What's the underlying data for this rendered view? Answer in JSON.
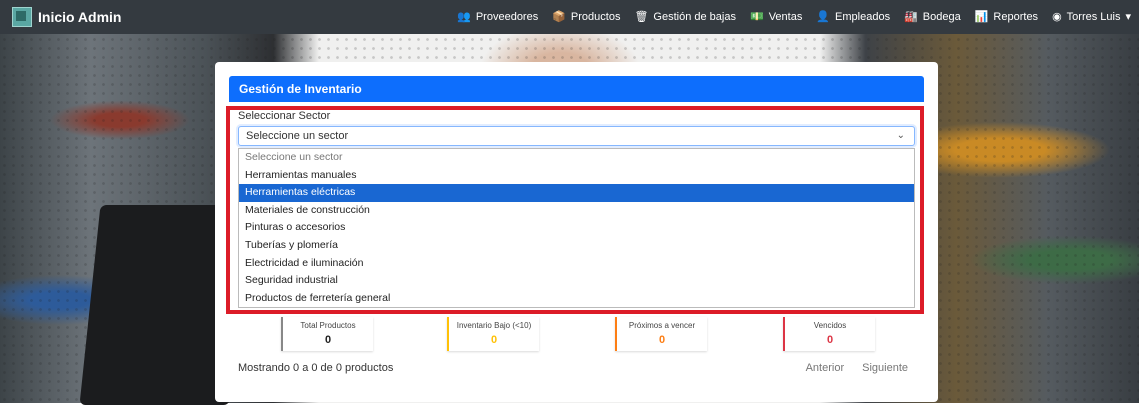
{
  "navbar": {
    "brand": "Inicio Admin",
    "items": [
      {
        "icon": "users-icon",
        "glyph": "👥",
        "label": "Proveedores"
      },
      {
        "icon": "box-icon",
        "glyph": "📦",
        "label": "Productos"
      },
      {
        "icon": "trash-icon",
        "glyph": "🗑",
        "label": "Gestión de bajas"
      },
      {
        "icon": "money-icon",
        "glyph": "💵",
        "label": "Ventas"
      },
      {
        "icon": "user-icon",
        "glyph": "👤",
        "label": "Empleados"
      },
      {
        "icon": "warehouse-icon",
        "glyph": "🏭",
        "label": "Bodega"
      },
      {
        "icon": "report-icon",
        "glyph": "📊",
        "label": "Reportes"
      }
    ],
    "user": "Torres Luis"
  },
  "card": {
    "title": "Gestión de Inventario",
    "sector_label": "Seleccionar Sector",
    "select_value": "Seleccione un sector",
    "options": [
      "Seleccione un sector",
      "Herramientas manuales",
      "Herramientas eléctricas",
      "Materiales de construcción",
      "Pinturas o accesorios",
      "Tuberías y plomería",
      "Electricidad e iluminación",
      "Seguridad industrial",
      "Productos de ferretería general"
    ],
    "selected_option": "Herramientas eléctricas"
  },
  "stats": [
    {
      "label": "Total Productos",
      "value": "0",
      "color": "#888888"
    },
    {
      "label": "Inventario Bajo (<10)",
      "value": "0",
      "color": "#ffc107"
    },
    {
      "label": "Próximos a vencer",
      "value": "0",
      "color": "#fd7e14"
    },
    {
      "label": "Vencidos",
      "value": "0",
      "color": "#dc3545"
    }
  ],
  "footer": {
    "showing": "Mostrando 0 a 0 de 0 productos",
    "prev": "Anterior",
    "next": "Siguiente"
  },
  "colors": {
    "navbar": "#343a40",
    "header": "#0d6efd",
    "highlight_frame": "#dc1c28",
    "selected_option": "#1967d2"
  }
}
